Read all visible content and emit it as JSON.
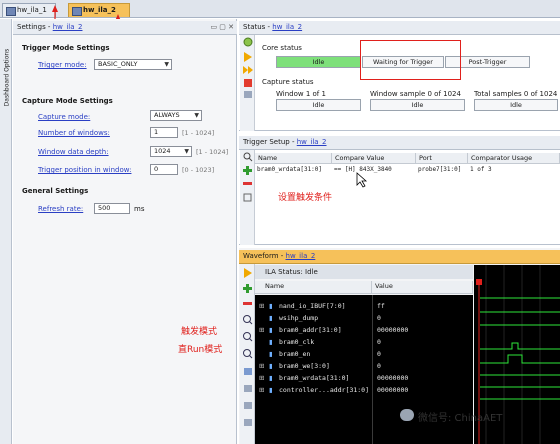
{
  "tabs": [
    {
      "label": "hw_ila_1",
      "active": false
    },
    {
      "label": "hw_ila_2",
      "active": true
    }
  ],
  "side_tab": {
    "label": "Dashboard Options"
  },
  "settings": {
    "header_prefix": "Settings - ",
    "header_link": "hw_ila_2",
    "trigger_mode_group": "Trigger Mode Settings",
    "trigger_mode_label": "Trigger mode:",
    "trigger_mode_value": "BASIC_ONLY",
    "capture_mode_group": "Capture Mode Settings",
    "capture_mode_label": "Capture mode:",
    "capture_mode_value": "ALWAYS",
    "num_windows_label": "Number of windows:",
    "num_windows_value": "1",
    "num_windows_range": "[1 - 1024]",
    "window_depth_label": "Window data depth:",
    "window_depth_value": "1024",
    "window_depth_range": "[1 - 1024]",
    "trigger_pos_label": "Trigger position in window:",
    "trigger_pos_value": "0",
    "trigger_pos_range": "[0 - 1023]",
    "general_group": "General Settings",
    "refresh_label": "Refresh rate:",
    "refresh_value": "500",
    "refresh_unit": "ms"
  },
  "status": {
    "header_prefix": "Status - ",
    "header_link": "hw_ila_2",
    "core_status_label": "Core status",
    "core_states": [
      "Idle",
      "Waiting for Trigger",
      "Post-Trigger"
    ],
    "capture_status_label": "Capture status",
    "window_label": "Window 1 of 1",
    "window_value": "Idle",
    "window_sample_label": "Window sample 0 of 1024",
    "window_sample_value": "Idle",
    "total_samples_label": "Total samples 0 of 1024",
    "total_samples_value": "Idle"
  },
  "trigger_setup": {
    "header_prefix": "Trigger Setup - ",
    "header_link": "hw_ila_2",
    "columns": [
      "Name",
      "Compare Value",
      "Port",
      "Comparator Usage"
    ],
    "rows": [
      {
        "name": "bram0_wrdata[31:0]",
        "compare": "== [H] 843X_3840",
        "port": "probe7[31:0]",
        "usage": "1 of 3"
      }
    ]
  },
  "waveform": {
    "header_prefix": "Waveform - ",
    "header_link": "hw_ila_2",
    "ila_status": "ILA Status: Idle",
    "columns": [
      "Name",
      "Value"
    ],
    "rows": [
      {
        "name": "nand_io_IBUF[7:0]",
        "value": "ff"
      },
      {
        "name": "wsihp_dump",
        "value": "0"
      },
      {
        "name": "bram0_addr[31:0]",
        "value": "00000000"
      },
      {
        "name": "bram0_clk",
        "value": "0"
      },
      {
        "name": "bram0_en",
        "value": "0"
      },
      {
        "name": "bram0_we[3:0]",
        "value": "0"
      },
      {
        "name": "bram0_wrdata[31:0]",
        "value": "00000000"
      },
      {
        "name": "controller...addr[31:0]",
        "value": "00000000"
      }
    ]
  },
  "annotations": {
    "trigger_condition": "设置触发条件",
    "trigger_mode": "触发模式",
    "run_mode": "直Run模式"
  },
  "watermark": "微信号: ChinaAET",
  "colors": {
    "accent_tab": "#f6c15a",
    "idle_green": "#7ee07a",
    "wave_green": "#2ee63a",
    "annotation_red": "#e0201c",
    "link_blue": "#2a3fc4"
  }
}
